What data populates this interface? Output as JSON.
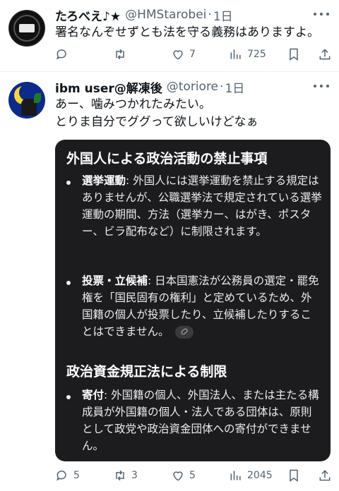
{
  "post1": {
    "name": "たろべえ♪★",
    "handle": "@HMStarobei",
    "time": "1日",
    "text": "署名なんぞせずとも法を守る義務はありますよ。",
    "counts": {
      "reply": "",
      "retweet": "",
      "like": "7",
      "views": "725"
    }
  },
  "post2": {
    "name": "ibm user@解凍後",
    "handle": "@toriore",
    "time": "1日",
    "text_lines": [
      "あー、噛みつかれたみたい。",
      "とりま自分でググって欲しいけどなぁ"
    ],
    "card": {
      "heading1": "外国人による政治活動の禁止事項",
      "item1_term": "選挙運動",
      "item1_body": ": 外国人には選挙運動を禁止する規定はありませんが、公職選挙法で規定されている選挙運動の期間、方法（選挙カー、はがき、ポスター、ビラ配布など）に制限されます。",
      "item2_term": "投票・立候補",
      "item2_body": ": 日本国憲法が公務員の選定・罷免権を「国民固有の権利」と定めているため、外国籍の個人が投票したり、立候補したりすることはできません。",
      "heading2": "政治資金規正法による制限",
      "item3_term": "寄付",
      "item3_body": ": 外国籍の個人、外国法人、または主たる構成員が外国籍の個人・法人である団体は、原則として政党や政治資金団体への寄付ができません。"
    },
    "counts": {
      "reply": "5",
      "retweet": "3",
      "like": "5",
      "views": "2045"
    }
  },
  "colors": {
    "text": "#0f1419",
    "muted": "#536471",
    "card_bg": "#1c1c1e"
  },
  "icons": [
    "reply-icon",
    "retweet-icon",
    "like-icon",
    "views-icon",
    "bookmark-icon",
    "share-icon",
    "more-icon",
    "link-icon"
  ]
}
